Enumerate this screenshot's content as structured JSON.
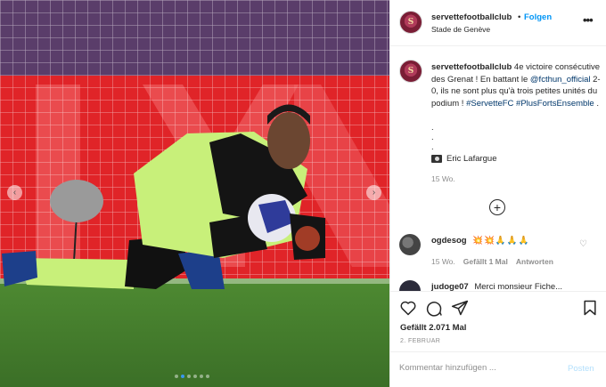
{
  "header": {
    "avatar_initial": "S",
    "username": "servettefootballclub",
    "separator": "•",
    "follow_label": "Folgen",
    "location": "Stade de Genève",
    "more_label": "•••"
  },
  "caption": {
    "avatar_initial": "S",
    "username": "servettefootballclub",
    "text_1": "4e victoire consécutive des Grenat ! En battant le",
    "mention": "@fcthun_official",
    "text_2": "2-0, ils ne sont plus qu'à trois petites unités du podium !",
    "hashtag_1": "#ServetteFC",
    "hashtag_2": "#PlusFortsEnsemble",
    "text_end": ".",
    "dot_lines": [
      ".",
      ".",
      "."
    ],
    "photo_credit": "Eric Lafargue",
    "time": "15 Wo."
  },
  "load_more": {
    "label": "+"
  },
  "comments": [
    {
      "username": "ogdesog",
      "text": "💥💥🙏🙏🙏",
      "time": "15 Wo.",
      "likes": "Gefällt 1 Mal",
      "reply": "Antworten",
      "heart": "♡"
    },
    {
      "username": "judoge07",
      "text": "Merci monsieur Fiche..."
    }
  ],
  "actions": {
    "likes": "Gefällt 2.071 Mal",
    "date": "2. FEBRUAR"
  },
  "comment_box": {
    "placeholder": "Kommentar hinzufügen ...",
    "post_label": "Posten"
  },
  "media": {
    "prev_arrow": "‹",
    "next_arrow": "›",
    "slide_count": 6,
    "active_slide": 1
  },
  "colors": {
    "link": "#00376b",
    "follow": "#0095f6",
    "post_disabled": "#b2dffc",
    "club_avatar": "#7a1d35"
  },
  "icons": [
    "heart-icon",
    "comment-icon",
    "share-icon",
    "bookmark-icon",
    "camera-icon",
    "plus-circle-icon"
  ]
}
